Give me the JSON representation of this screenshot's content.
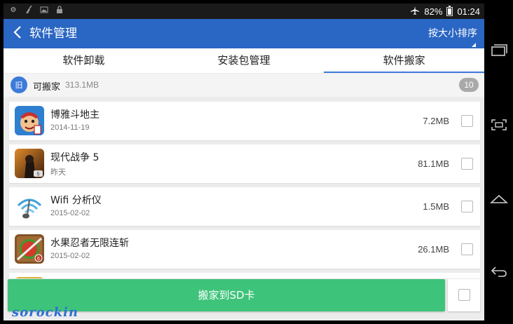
{
  "status_bar": {
    "battery": "82%",
    "battery_level": 0.82,
    "time": "01:24"
  },
  "header": {
    "title": "软件管理",
    "sort_label": "按大小排序"
  },
  "tabs": [
    {
      "label": "软件卸载"
    },
    {
      "label": "安装包管理"
    },
    {
      "label": "软件搬家"
    }
  ],
  "section": {
    "icon_text": "旧",
    "label": "可搬家",
    "size": "313.1MB",
    "count": "10"
  },
  "apps": [
    {
      "name": "博雅斗地主",
      "date": "2014-11-19",
      "size": "7.2MB",
      "icon": "poker-game-icon"
    },
    {
      "name": "现代战争 5",
      "date": "昨天",
      "size": "81.1MB",
      "icon": "shooter-game-icon"
    },
    {
      "name": "Wifi 分析仪",
      "date": "2015-02-02",
      "size": "1.5MB",
      "icon": "wifi-analyzer-icon"
    },
    {
      "name": "水果忍者无限连斩",
      "date": "2015-02-02",
      "size": "26.1MB",
      "icon": "fruit-ninja-icon"
    }
  ],
  "footer": {
    "move_button": "搬家到SD卡"
  },
  "watermark": "sorockin",
  "colors": {
    "app_bar": "#2a66c3",
    "tab_indicator": "#3d7bd9",
    "move_button": "#3ec37a"
  }
}
